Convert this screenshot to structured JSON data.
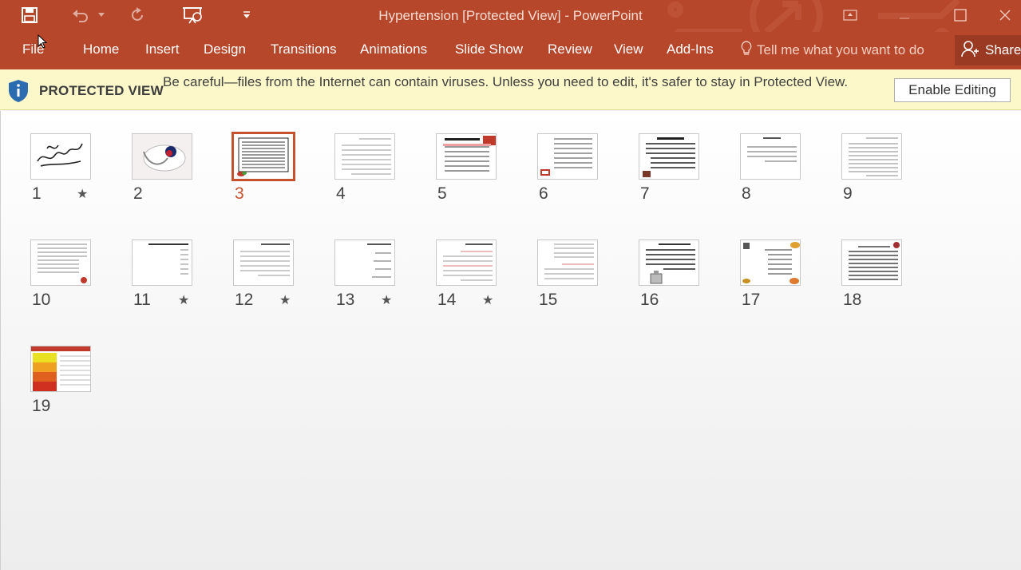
{
  "window": {
    "title": "Hypertension [Protected View] - PowerPoint"
  },
  "ribbon": {
    "tabs": [
      {
        "label": "File"
      },
      {
        "label": "Home"
      },
      {
        "label": "Insert"
      },
      {
        "label": "Design"
      },
      {
        "label": "Transitions"
      },
      {
        "label": "Animations"
      },
      {
        "label": "Slide Show"
      },
      {
        "label": "Review"
      },
      {
        "label": "View"
      },
      {
        "label": "Add-Ins"
      }
    ],
    "tell_me_placeholder": "Tell me what you want to do",
    "share_label": "Share"
  },
  "protected_view": {
    "title": "PROTECTED VIEW",
    "message": "Be careful—files from the Internet can contain viruses. Unless you need to edit, it's safer to stay in Protected View.",
    "enable_button": "Enable Editing"
  },
  "slides": [
    {
      "number": "1",
      "has_animation": true
    },
    {
      "number": "2",
      "has_animation": false
    },
    {
      "number": "3",
      "has_animation": false,
      "selected": true
    },
    {
      "number": "4",
      "has_animation": false
    },
    {
      "number": "5",
      "has_animation": false
    },
    {
      "number": "6",
      "has_animation": false
    },
    {
      "number": "7",
      "has_animation": false
    },
    {
      "number": "8",
      "has_animation": false
    },
    {
      "number": "9",
      "has_animation": false
    },
    {
      "number": "10",
      "has_animation": false
    },
    {
      "number": "11",
      "has_animation": true
    },
    {
      "number": "12",
      "has_animation": true
    },
    {
      "number": "13",
      "has_animation": true
    },
    {
      "number": "14",
      "has_animation": true
    },
    {
      "number": "15",
      "has_animation": false
    },
    {
      "number": "16",
      "has_animation": false
    },
    {
      "number": "17",
      "has_animation": false
    },
    {
      "number": "18",
      "has_animation": false
    },
    {
      "number": "19",
      "has_animation": false
    }
  ],
  "colors": {
    "accent": "#b7472a",
    "selected_outline": "#c5522f",
    "protected_bar": "#fcf8c9"
  }
}
